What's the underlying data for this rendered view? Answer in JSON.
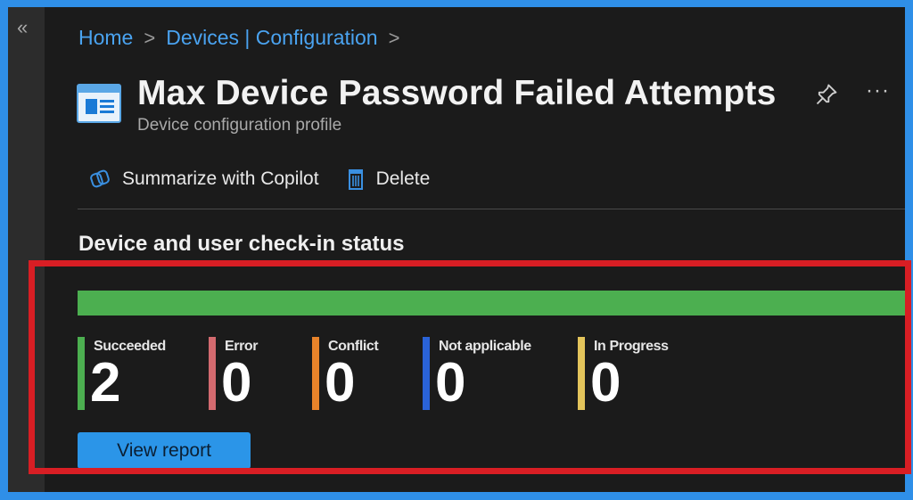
{
  "nav": {
    "collapse_glyph": "«",
    "collapse_icon": "double-chevron-left-icon"
  },
  "breadcrumb": [
    {
      "label": "Home"
    },
    {
      "label": "Devices | Configuration"
    }
  ],
  "breadcrumb_separator": ">",
  "header": {
    "title": "Max Device Password Failed Attempts",
    "subtitle": "Device configuration profile",
    "icon": "configuration-profile-icon",
    "pin_icon": "pin-icon",
    "more_label": "···"
  },
  "toolbar": {
    "summarize_label": "Summarize with Copilot",
    "delete_label": "Delete"
  },
  "status": {
    "section_title": "Device and user check-in status",
    "succeeded_fraction": 1.0,
    "items": [
      {
        "label": "Succeeded",
        "value": "2",
        "color": "#4caf50"
      },
      {
        "label": "Error",
        "value": "0",
        "color": "#d36a6f"
      },
      {
        "label": "Conflict",
        "value": "0",
        "color": "#e8832a"
      },
      {
        "label": "Not applicable",
        "value": "0",
        "color": "#2a63d8"
      },
      {
        "label": "In Progress",
        "value": "0",
        "color": "#e3c45b"
      }
    ],
    "view_report_label": "View report"
  },
  "colors": {
    "outer_border": "#2f8fe8",
    "highlight_box": "#d81e24",
    "link": "#4aa3f0",
    "background": "#1b1b1b"
  }
}
